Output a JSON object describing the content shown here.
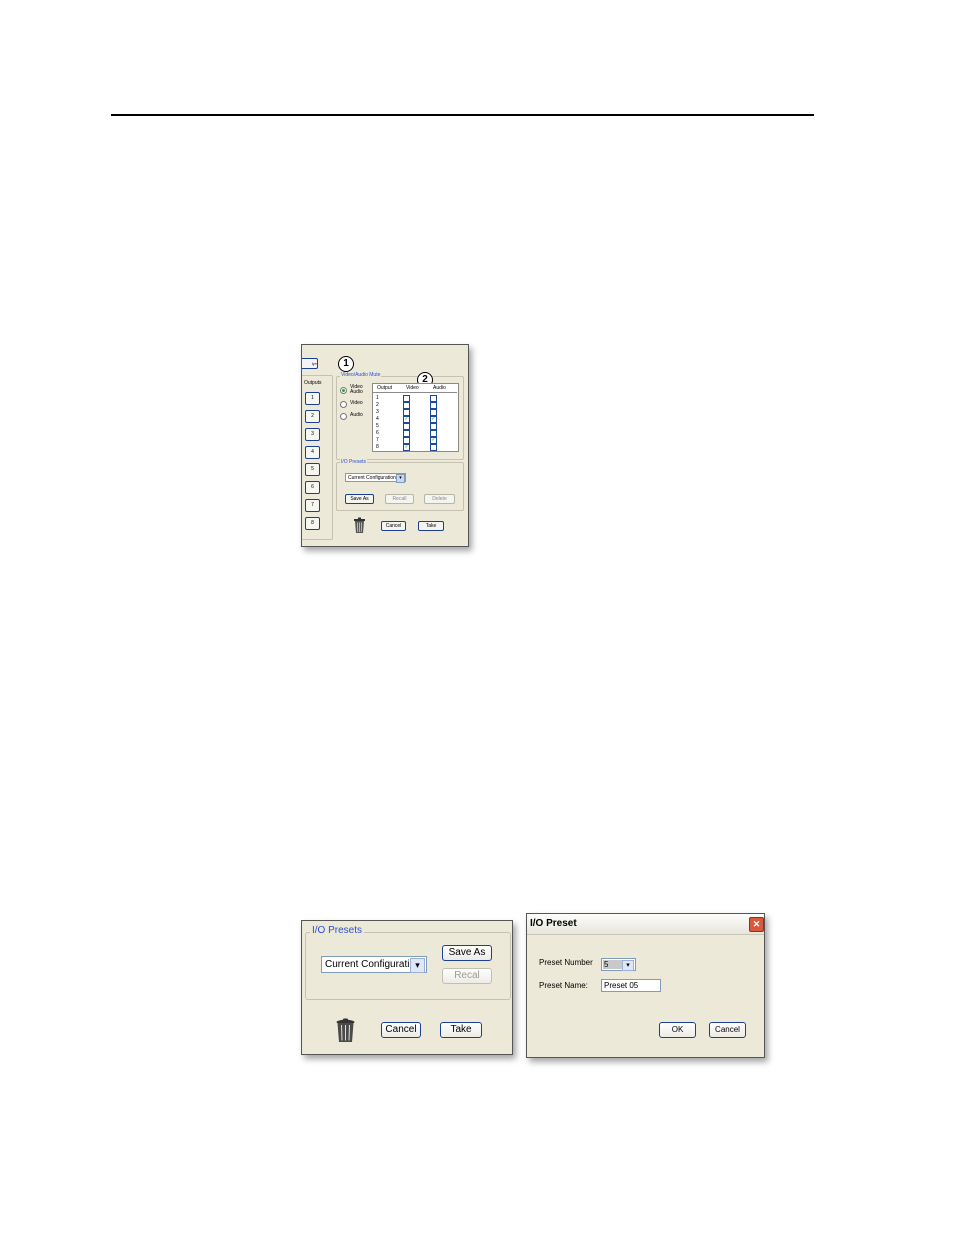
{
  "figure1": {
    "top_button": "ly»",
    "outputs_label": "Outputs",
    "output_buttons": [
      "1",
      "2",
      "3",
      "4",
      "5",
      "6",
      "7",
      "8"
    ],
    "mute_group_title": "Video/Audio Mute",
    "callouts": [
      "1",
      "2"
    ],
    "radio_options": [
      {
        "label": "Video Audio",
        "selected": true
      },
      {
        "label": "Video",
        "selected": false
      },
      {
        "label": "Audio",
        "selected": false
      }
    ],
    "table_headers": [
      "Output",
      "Video",
      "Audio"
    ],
    "table_rows": [
      {
        "output": "1",
        "video": false,
        "audio": false
      },
      {
        "output": "2",
        "video": false,
        "audio": false
      },
      {
        "output": "3",
        "video": false,
        "audio": false
      },
      {
        "output": "4",
        "video": true,
        "audio": true
      },
      {
        "output": "5",
        "video": false,
        "audio": false
      },
      {
        "output": "6",
        "video": false,
        "audio": false
      },
      {
        "output": "7",
        "video": false,
        "audio": true
      },
      {
        "output": "8",
        "video": true,
        "audio": false
      }
    ],
    "check_mark": "✓",
    "presets_group_title": "I/O Presets",
    "preset_select": "Current Configuration",
    "buttons": {
      "save_as": "Save As",
      "recall": "Recall",
      "delete": "Delete",
      "cancel": "Cancel",
      "take": "Take"
    },
    "dropdown_arrow": "▾"
  },
  "figure2": {
    "group_title": "I/O Presets",
    "preset_select": "Current Configuration",
    "buttons": {
      "save_as": "Save As",
      "recall": "Recal",
      "cancel": "Cancel",
      "take": "Take"
    },
    "dropdown_arrow": "▾"
  },
  "figure3": {
    "title": "I/O Preset",
    "close_glyph": "✕",
    "preset_number_label": "Preset Number",
    "preset_number_value": "5",
    "preset_name_label": "Preset Name:",
    "preset_name_value": "Preset 05",
    "buttons": {
      "ok": "OK",
      "cancel": "Cancel"
    },
    "dropdown_arrow": "▾"
  },
  "colors": {
    "window_bg": "#ece9d8",
    "group_title": "#2a4fd6",
    "button_border": "#1c3f94",
    "check": "#1e9b1e",
    "close": "#d9593f"
  }
}
